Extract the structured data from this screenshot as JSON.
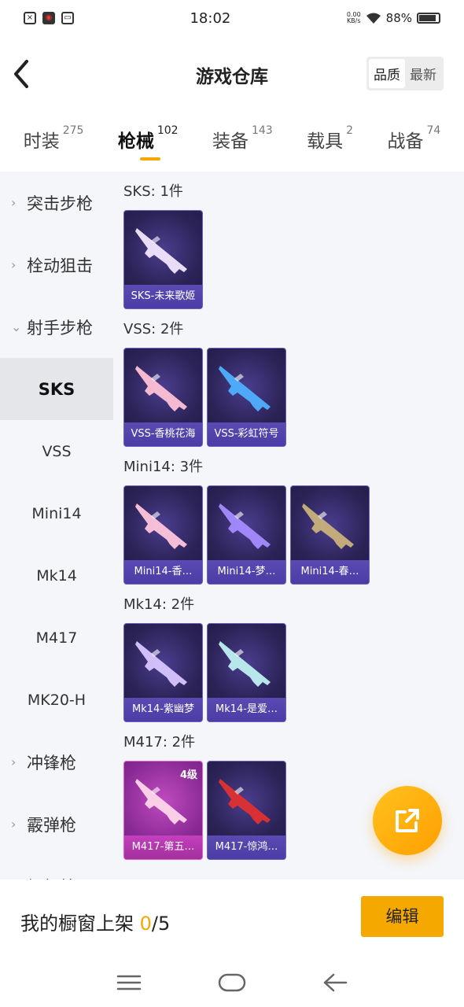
{
  "status_bar": {
    "time": "18:02",
    "net_speed_value": "0.00",
    "net_speed_unit": "KB/s",
    "battery": "88%",
    "battery_level": 0.88,
    "left_icons": [
      "close-box-icon",
      "app-red-icon",
      "sim-card-icon"
    ]
  },
  "header": {
    "back_icon": "chevron-left-icon",
    "title": "游戏仓库",
    "sort_options": [
      "品质",
      "最新"
    ],
    "sort_active": "品质"
  },
  "tabs": [
    {
      "label": "时装",
      "count": "275"
    },
    {
      "label": "枪械",
      "count": "102"
    },
    {
      "label": "装备",
      "count": "143"
    },
    {
      "label": "载具",
      "count": "2"
    },
    {
      "label": "战备",
      "count": "74"
    }
  ],
  "active_tab": "枪械",
  "sidebar": {
    "items": [
      {
        "label": "突击步枪",
        "type": "category",
        "expanded": false
      },
      {
        "label": "栓动狙击",
        "type": "category",
        "expanded": false
      },
      {
        "label": "射手步枪",
        "type": "category",
        "expanded": true
      },
      {
        "label": "SKS",
        "type": "sub",
        "active": true
      },
      {
        "label": "VSS",
        "type": "sub"
      },
      {
        "label": "Mini14",
        "type": "sub"
      },
      {
        "label": "Mk14",
        "type": "sub"
      },
      {
        "label": "M417",
        "type": "sub"
      },
      {
        "label": "MK20-H",
        "type": "sub"
      },
      {
        "label": "冲锋枪",
        "type": "category",
        "expanded": false
      },
      {
        "label": "霰弹枪",
        "type": "category",
        "expanded": false
      },
      {
        "label": "轻机枪",
        "type": "category",
        "expanded": false
      }
    ]
  },
  "groups": [
    {
      "title": "SKS: 1件",
      "items": [
        {
          "label": "SKS-未来歌姬",
          "color": "#f2e6ff"
        }
      ]
    },
    {
      "title": "VSS: 2件",
      "items": [
        {
          "label": "VSS-香桃花海",
          "color": "#ffc2d6"
        },
        {
          "label": "VSS-彩虹符号",
          "color": "#4fb0ff"
        }
      ]
    },
    {
      "title": "Mini14: 3件",
      "items": [
        {
          "label": "Mini14-香…",
          "color": "#ffc6dc"
        },
        {
          "label": "Mini14-梦…",
          "color": "#a58cff"
        },
        {
          "label": "Mini14-春…",
          "color": "#c9b27a"
        }
      ]
    },
    {
      "title": "Mk14: 2件",
      "items": [
        {
          "label": "Mk14-紫幽梦",
          "color": "#d8c6ff"
        },
        {
          "label": "Mk14-是爱…",
          "color": "#bff0f0"
        }
      ]
    },
    {
      "title": "M417: 2件",
      "items": [
        {
          "label": "M417-第五…",
          "color": "#ffd6ea",
          "badge": "4级",
          "highlight": true
        },
        {
          "label": "M417-惊鸿…",
          "color": "#e03030"
        }
      ]
    }
  ],
  "fab": {
    "icon": "share-external-icon"
  },
  "bottom": {
    "showcase_label": "我的橱窗上架",
    "count_current": "0",
    "count_total": "/5",
    "edit_label": "编辑"
  },
  "nav": {
    "icons": [
      "menu-icon",
      "home-icon",
      "back-icon"
    ]
  },
  "colors": {
    "accent": "#f5a800",
    "card_bg": "#2b2356",
    "card_label": "#5a4bb3",
    "card_highlight": "#a2309d"
  }
}
